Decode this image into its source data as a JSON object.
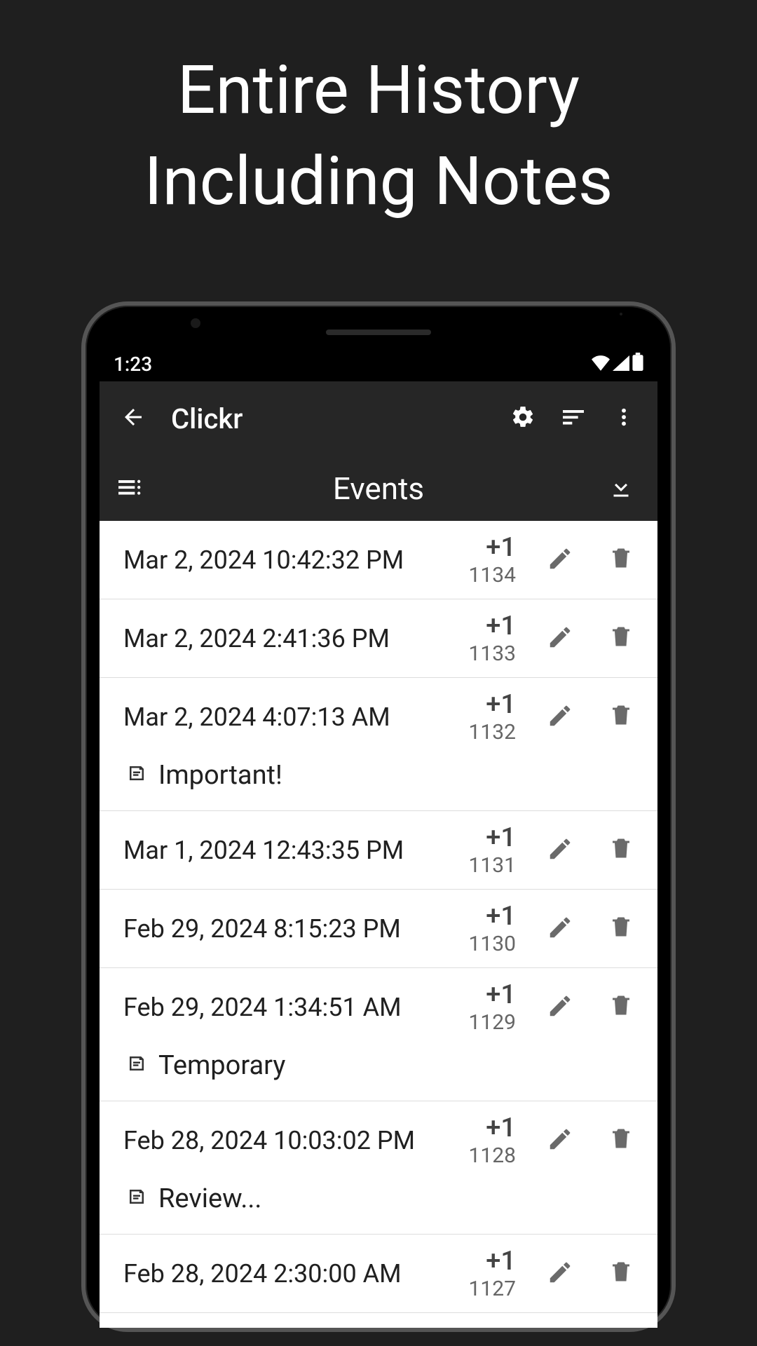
{
  "promo": {
    "line1": "Entire History",
    "line2": "Including Notes"
  },
  "status": {
    "time": "1:23"
  },
  "appbar": {
    "title": "Clickr"
  },
  "toolbar": {
    "title": "Events"
  },
  "events": [
    {
      "date": "Mar 2, 2024 10:42:32 PM",
      "inc": "+1",
      "count": "1134",
      "note": null
    },
    {
      "date": "Mar 2, 2024 2:41:36 PM",
      "inc": "+1",
      "count": "1133",
      "note": null
    },
    {
      "date": "Mar 2, 2024 4:07:13 AM",
      "inc": "+1",
      "count": "1132",
      "note": "Important!"
    },
    {
      "date": "Mar 1, 2024 12:43:35 PM",
      "inc": "+1",
      "count": "1131",
      "note": null
    },
    {
      "date": "Feb 29, 2024 8:15:23 PM",
      "inc": "+1",
      "count": "1130",
      "note": null
    },
    {
      "date": "Feb 29, 2024 1:34:51 AM",
      "inc": "+1",
      "count": "1129",
      "note": "Temporary"
    },
    {
      "date": "Feb 28, 2024 10:03:02 PM",
      "inc": "+1",
      "count": "1128",
      "note": "Review..."
    },
    {
      "date": "Feb 28, 2024 2:30:00 AM",
      "inc": "+1",
      "count": "1127",
      "note": null
    }
  ]
}
